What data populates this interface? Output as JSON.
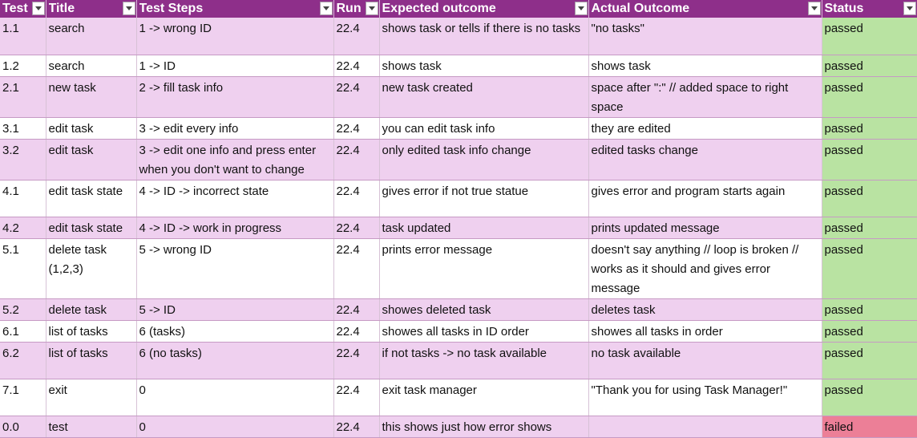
{
  "columns": [
    "Test ID",
    "Title",
    "Test Steps",
    "Run",
    "Expected outcome",
    "Actual Outcome",
    "Status"
  ],
  "rows": [
    {
      "id": "1.1",
      "title": "search",
      "steps": "1 -> wrong ID",
      "run": "22.4",
      "expected": "shows task or tells if there is no tasks",
      "actual": "\"no tasks\"",
      "status": "passed"
    },
    {
      "id": "1.2",
      "title": "search",
      "steps": "1 -> ID",
      "run": "22.4",
      "expected": "shows task",
      "actual": "shows task",
      "status": "passed"
    },
    {
      "id": "2.1",
      "title": "new task",
      "steps": "2 -> fill task info",
      "run": "22.4",
      "expected": "new task created",
      "actual": "space after \":\" // added space to right space",
      "status": "passed"
    },
    {
      "id": "3.1",
      "title": "edit task",
      "steps": "3 -> edit every info",
      "run": "22.4",
      "expected": "you can edit task info",
      "actual": "they are edited",
      "status": "passed"
    },
    {
      "id": "3.2",
      "title": "edit task",
      "steps": "3 -> edit one info and press enter when you don't want to change",
      "run": "22.4",
      "expected": "only edited task info change",
      "actual": "edited tasks change",
      "status": "passed"
    },
    {
      "id": "4.1",
      "title": "edit task state",
      "steps": "4 -> ID -> incorrect state",
      "run": "22.4",
      "expected": "gives error if not true statue",
      "actual": "gives error and program starts again",
      "status": "passed"
    },
    {
      "id": "4.2",
      "title": "edit task state",
      "steps": "4 -> ID -> work in progress",
      "run": "22.4",
      "expected": "task updated",
      "actual": "prints updated message",
      "status": "passed"
    },
    {
      "id": "5.1",
      "title": "delete task (1,2,3)",
      "steps": "5 -> wrong ID",
      "run": "22.4",
      "expected": "prints error message",
      "actual": "doesn't say anything // loop is broken // works as it should and gives error message",
      "status": "passed"
    },
    {
      "id": "5.2",
      "title": "delete task",
      "steps": "5 -> ID",
      "run": "22.4",
      "expected": "showes deleted task",
      "actual": "deletes task",
      "status": "passed"
    },
    {
      "id": "6.1",
      "title": "list of tasks",
      "steps": "6 (tasks)",
      "run": "22.4",
      "expected": "showes all tasks in ID order",
      "actual": "showes all tasks in order",
      "status": "passed"
    },
    {
      "id": "6.2",
      "title": "list of tasks",
      "steps": " 6 (no tasks)",
      "run": "22.4",
      "expected": "if not tasks -> no task available",
      "actual": "no task available",
      "status": "passed"
    },
    {
      "id": "7.1",
      "title": "exit",
      "steps": "0",
      "run": "22.4",
      "expected": "exit task manager",
      "actual": "\"Thank you for using Task Manager!\"",
      "status": "passed"
    },
    {
      "id": "0.0",
      "title": "test",
      "steps": "0",
      "run": "22.4",
      "expected": "this shows just how error shows",
      "actual": "",
      "status": "failed"
    }
  ],
  "colors": {
    "header": "#8e2f8a",
    "row_band": "#efd0ef",
    "passed": "#b9e3a2",
    "failed": "#ec7f97"
  },
  "icons": {
    "filter": "filter-dropdown-icon"
  }
}
